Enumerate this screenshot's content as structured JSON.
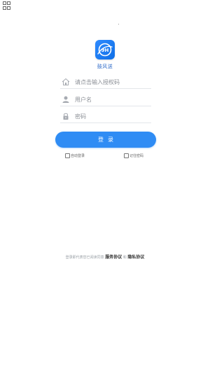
{
  "app": {
    "logo_text": "9H",
    "name": "鼓风送"
  },
  "login_form": {
    "auth_code_placeholder": "请点击输入授权码",
    "username_placeholder": "用户名",
    "password_placeholder": "密码",
    "login_label": "登录",
    "auto_login_label": "自动登录",
    "remember_password_label": "记住密码"
  },
  "agreement": {
    "prefix": "登录即代表您已阅读同意",
    "service_link": "服务协议",
    "separator": "和",
    "privacy_link": "隐私协议"
  },
  "colors": {
    "accent": "#2f8cf4",
    "logo_bg": "#1a7af0",
    "brand_text": "#2f6bc8"
  }
}
